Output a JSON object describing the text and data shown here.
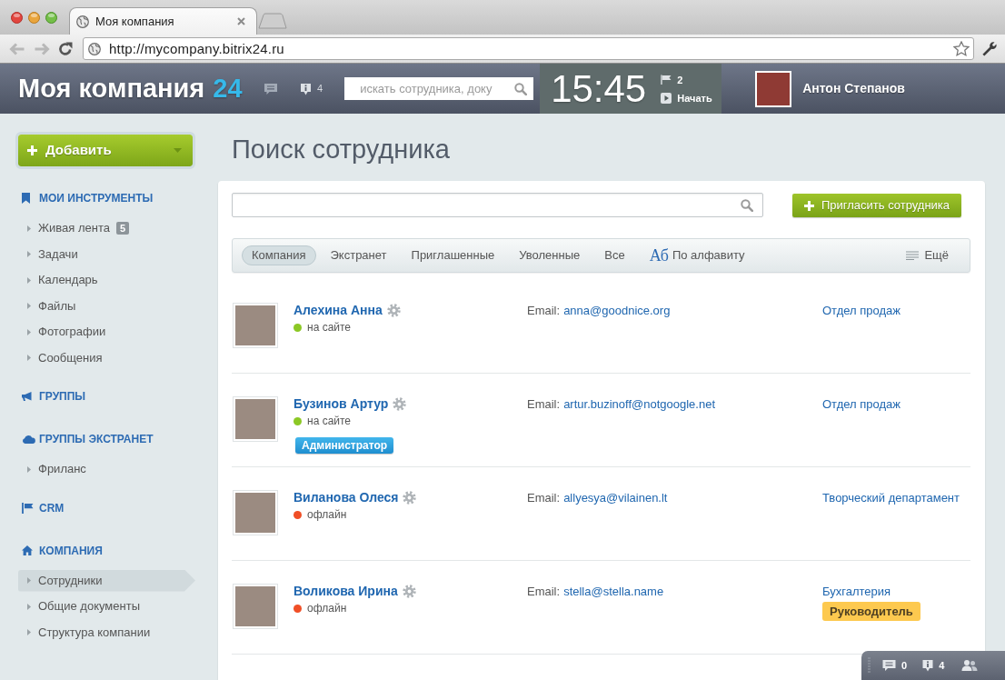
{
  "browser": {
    "tab_title": "Моя компания",
    "url": "http://mycompany.bitrix24.ru"
  },
  "header": {
    "logo": "Моя компания",
    "logo_number": "24",
    "notifications_count": "4",
    "search_placeholder": "искать сотрудника, доку",
    "clock": "15:45",
    "tasks_count": "2",
    "start_label": "Начать",
    "user_name": "Антон Степанов"
  },
  "sidebar": {
    "add_button": "Добавить",
    "sections": [
      {
        "title": "МОИ ИНСТРУМЕНТЫ",
        "kind": "tools",
        "items": [
          {
            "label": "Живая лента",
            "counter": "5",
            "selected": false
          },
          {
            "label": "Задачи",
            "selected": false
          },
          {
            "label": "Календарь",
            "selected": false
          },
          {
            "label": "Файлы",
            "selected": false
          },
          {
            "label": "Фотографии",
            "selected": false
          },
          {
            "label": "Сообщения",
            "selected": false
          }
        ]
      },
      {
        "title": "ГРУППЫ",
        "kind": "groups"
      },
      {
        "title": "ГРУППЫ ЭКСТРАНЕТ",
        "kind": "extranet",
        "items": [
          {
            "label": "Фриланс",
            "selected": false
          }
        ]
      },
      {
        "title": "CRM",
        "kind": "crm"
      },
      {
        "title": "КОМПАНИЯ",
        "kind": "company",
        "items": [
          {
            "label": "Сотрудники",
            "selected": true
          },
          {
            "label": "Общие документы",
            "selected": false
          },
          {
            "label": "Структура компании",
            "selected": false
          }
        ]
      }
    ]
  },
  "main": {
    "title": "Поиск сотрудника",
    "invite_button": "Пригласить сотрудника",
    "filters": [
      {
        "label": "Компания",
        "selected": true
      },
      {
        "label": "Экстранет",
        "selected": false
      },
      {
        "label": "Приглашенные",
        "selected": false
      },
      {
        "label": "Уволенные",
        "selected": false
      },
      {
        "label": "Все",
        "selected": false
      }
    ],
    "sort": {
      "glyph": "Аб",
      "label": "По алфавиту"
    },
    "more": "Ещё"
  },
  "employees": [
    {
      "name": "Алехина Анна",
      "online": true,
      "status": "на сайте",
      "email_label": "Email:",
      "email": "anna@goodnice.org",
      "department": "Отдел продаж"
    },
    {
      "name": "Бузинов Артур",
      "online": true,
      "status": "на сайте",
      "role_badge": {
        "kind": "admin",
        "text": "Администратор"
      },
      "email_label": "Email:",
      "email": "artur.buzinoff@notgoogle.net",
      "department": "Отдел продаж"
    },
    {
      "name": "Виланова Олеся",
      "online": false,
      "status": "офлайн",
      "email_label": "Email:",
      "email": "allyesya@vilainen.lt",
      "department": "Творческий департамент"
    },
    {
      "name": "Воликова Ирина",
      "online": false,
      "status": "офлайн",
      "email_label": "Email:",
      "email": "stella@stella.name",
      "department": "Бухгалтерия",
      "role_badge": {
        "kind": "head",
        "text": "Руководитель"
      }
    }
  ],
  "footer": {
    "messages_count": "0",
    "notifications_count": "4"
  }
}
